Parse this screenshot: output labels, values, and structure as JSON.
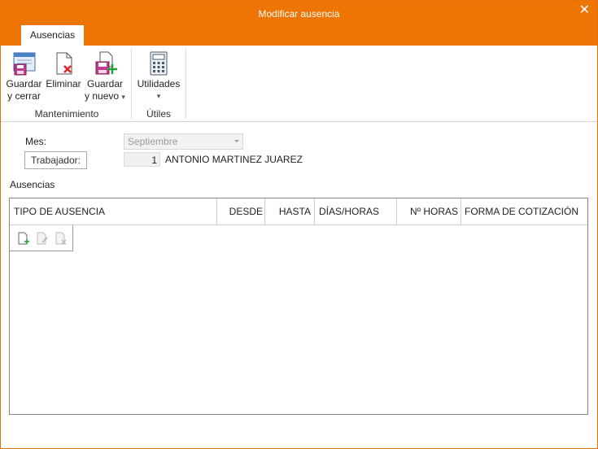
{
  "window": {
    "title": "Modificar ausencia",
    "close_glyph": "✕"
  },
  "tabs": [
    {
      "label": "Ausencias",
      "active": true
    }
  ],
  "ribbon": {
    "groups": [
      {
        "label": "Mantenimiento"
      },
      {
        "label": "Útiles"
      }
    ],
    "buttons": {
      "guardar_cerrar": {
        "line1": "Guardar",
        "line2": "y cerrar",
        "icon": "save-close-icon"
      },
      "eliminar": {
        "line1": "Eliminar",
        "icon": "delete-document-icon"
      },
      "guardar_nuevo": {
        "line1": "Guardar",
        "line2": "y nuevo",
        "dropdown": "▾",
        "icon": "save-new-icon"
      },
      "utilidades": {
        "line1": "Utilidades",
        "dropdown": "▾",
        "icon": "calculator-icon"
      }
    }
  },
  "form": {
    "mes_label": "Mes:",
    "mes_value": "Septiembre",
    "trabajador_label": "Trabajador:",
    "trabajador_number": "1",
    "trabajador_name": "ANTONIO MARTINEZ JUAREZ"
  },
  "ausencias": {
    "section_label": "Ausencias",
    "columns": [
      "TIPO DE AUSENCIA",
      "DESDE",
      "HASTA",
      "DÍAS/HORAS",
      "Nº HORAS",
      "FORMA DE COTIZACIÓN"
    ],
    "rows": [],
    "toolbar_icons": [
      "new-row-icon",
      "edit-row-icon",
      "delete-row-icon"
    ]
  },
  "colors": {
    "accent": "#ee7404",
    "title_text": "#ffffff",
    "disabled": "#999999"
  }
}
